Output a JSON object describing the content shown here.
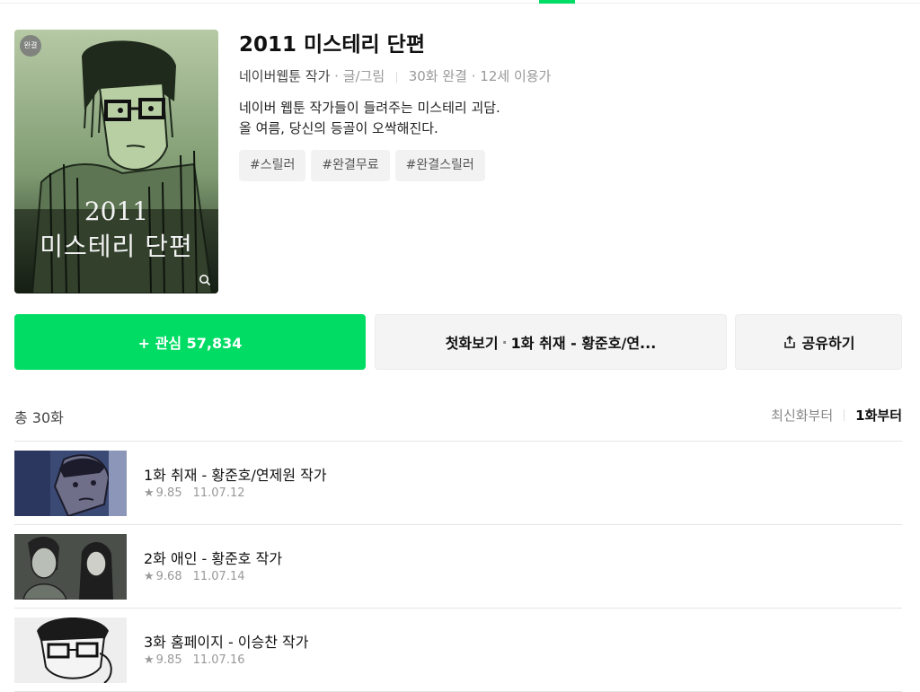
{
  "header": {
    "accent_color": "#00dc64"
  },
  "cover": {
    "badge": "완결",
    "title_line1": "2011",
    "title_line2": "미스테리 단편",
    "zoom_icon": "search-icon"
  },
  "info": {
    "title": "2011 미스테리 단편",
    "author": "네이버웹툰 작가",
    "role": "· 글/그림",
    "episodes_status": "30화 완결",
    "age": "· 12세 이용가",
    "desc_line1": "네이버 웹툰 작가들이 들려주는 미스테리 괴담.",
    "desc_line2": "올 여름, 당신의 등골이 오싹해진다.",
    "tags": [
      "#스릴러",
      "#완결무료",
      "#완결스릴러"
    ]
  },
  "actions": {
    "like_label": "+ 관심 57,834",
    "first_label_a": "첫화보기",
    "first_dot": "·",
    "first_label_b": "1화 취재 - 황준호/연...",
    "share_label": "공유하기"
  },
  "list_header": {
    "count": "총 30화",
    "sort_latest": "최신화부터",
    "sort_first": "1화부터"
  },
  "episodes": [
    {
      "title": "1화 취재 - 황준호/연제원 작가",
      "rating": "9.85",
      "date": "11.07.12"
    },
    {
      "title": "2화 애인 - 황준호 작가",
      "rating": "9.68",
      "date": "11.07.14"
    },
    {
      "title": "3화 홈페이지 - 이승찬 작가",
      "rating": "9.85",
      "date": "11.07.16"
    }
  ]
}
